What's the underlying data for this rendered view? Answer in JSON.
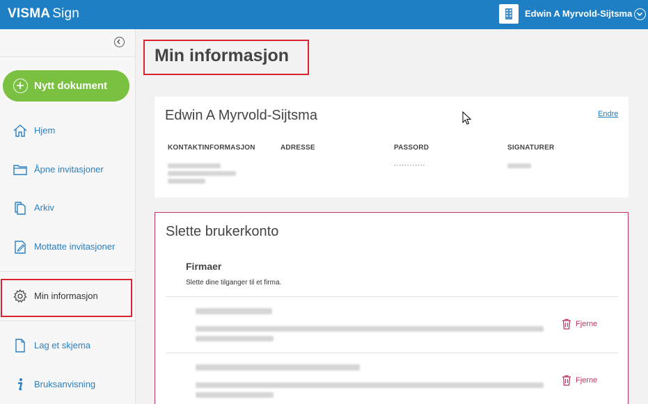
{
  "header": {
    "brand_bold": "VISMA",
    "brand_light": "Sign",
    "user_name": "Edwin A Myrvold-Sijtsma"
  },
  "sidebar": {
    "new_document": "Nytt dokument",
    "items": [
      {
        "label": "Hjem",
        "icon": "home-icon"
      },
      {
        "label": "Åpne invitasjoner",
        "icon": "folder-icon"
      },
      {
        "label": "Arkiv",
        "icon": "archive-icon"
      },
      {
        "label": "Mottatte invitasjoner",
        "icon": "edit-document-icon"
      },
      {
        "label": "Min informasjon",
        "icon": "gear-icon",
        "active": true
      },
      {
        "label": "Lag et skjema",
        "icon": "document-icon"
      },
      {
        "label": "Bruksanvisning",
        "icon": "info-icon"
      }
    ]
  },
  "main": {
    "page_title": "Min informasjon",
    "profile": {
      "name": "Edwin A Myrvold-Sijtsma",
      "edit_label": "Endre",
      "columns": [
        "KONTAKTINFORMASJON",
        "ADRESSE",
        "PASSORD",
        "SIGNATURER"
      ],
      "password_mask": "............"
    },
    "delete_account": {
      "heading": "Slette brukerkonto",
      "companies_title": "Firmaer",
      "companies_desc": "Slette dine tilganger til et firma.",
      "remove_label": "Fjerne"
    }
  },
  "colors": {
    "topbar": "#1e7fc4",
    "accent_green": "#7ac142",
    "highlight_red": "#d9232e",
    "danger": "#c0335e"
  }
}
